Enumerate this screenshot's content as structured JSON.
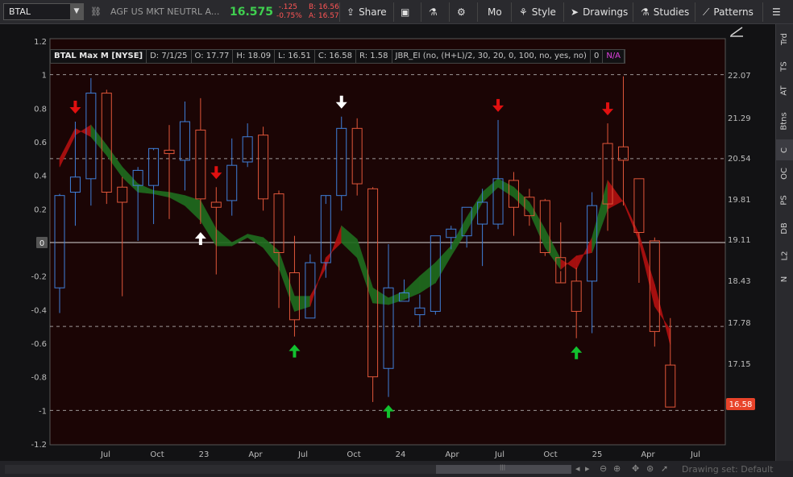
{
  "toolbar": {
    "symbol": "BTAL",
    "description": "AGF US MKT NEUTRL A...",
    "last_price": "16.575",
    "net_change": "-.125",
    "pct_change": "-0.75%",
    "bid": "B: 16.56",
    "ask": "A: 16.57",
    "share_label": "Share",
    "mo_label": "Mo",
    "style_label": "Style",
    "drawings_label": "Drawings",
    "studies_label": "Studies",
    "patterns_label": "Patterns",
    "icons": [
      "link-icon",
      "share-icon",
      "screenshot-icon",
      "flask-icon",
      "gear-icon",
      "style-icon",
      "cursor-icon",
      "studies-flask-icon",
      "patterns-icon",
      "menu-icon"
    ]
  },
  "header": {
    "title": "BTAL Max M [NYSE]",
    "date": "D: 7/1/25",
    "open": "O: 17.77",
    "high": "H: 18.09",
    "low": "L: 16.51",
    "close": "C: 16.58",
    "range": "R: 1.58",
    "study": "JBR_EI (no, (H+L)/2, 30, 20, 0, 100, no, yes, no)",
    "study_value": "0",
    "na": "N/A"
  },
  "sidebar_tabs": [
    "Trd",
    "TS",
    "AT",
    "Btns",
    "C",
    "OC",
    "PS",
    "DB",
    "L2",
    "N"
  ],
  "sidebar_active": "C",
  "bottom": {
    "drawing_set": "Drawing set: Default"
  },
  "colors": {
    "up_candle": "#3f7fd9",
    "down_candle": "#e0563a",
    "band_bull": "#1f6b1f",
    "band_bear": "#b01010",
    "arrow_down": "#e01010",
    "arrow_up_green": "#12c12f",
    "arrow_white": "#ffffff",
    "last_price_tag": "#e8432a"
  },
  "chart_data": {
    "type": "candlestick",
    "left_axis": {
      "ticks": [
        "1.2",
        "1",
        "0.8",
        "0.6",
        "0.4",
        "0.2",
        "0",
        "-0.2",
        "-0.4",
        "-0.6",
        "-0.8",
        "-1",
        "-1.2"
      ],
      "dashed_levels": [
        1,
        0.5,
        -0.5,
        -1
      ],
      "zero_level": 0,
      "zero_label": "0",
      "range": [
        -1.2,
        1.2
      ]
    },
    "right_axis": {
      "ticks": [
        "22.07",
        "21.29",
        "20.54",
        "19.81",
        "19.11",
        "18.43",
        "17.78",
        "17.15"
      ],
      "last_price_label": "16.58",
      "last_price": 16.58
    },
    "x_labels": [
      "Jul",
      "Oct",
      "23",
      "Apr",
      "Jul",
      "Oct",
      "24",
      "Apr",
      "Jul",
      "Oct",
      "25",
      "Apr",
      "Jul"
    ],
    "candles": [
      {
        "o": -0.27,
        "h": 0.29,
        "l": -0.42,
        "c": 0.28
      },
      {
        "o": 0.3,
        "h": 0.72,
        "l": 0.1,
        "c": 0.39
      },
      {
        "o": 0.38,
        "h": 0.98,
        "l": 0.22,
        "c": 0.89
      },
      {
        "o": 0.89,
        "h": 0.91,
        "l": 0.23,
        "c": 0.3
      },
      {
        "o": 0.33,
        "h": 0.39,
        "l": -0.32,
        "c": 0.24
      },
      {
        "o": 0.34,
        "h": 0.45,
        "l": 0.01,
        "c": 0.43
      },
      {
        "o": 0.34,
        "h": 0.55,
        "l": 0.11,
        "c": 0.56
      },
      {
        "o": 0.55,
        "h": 0.7,
        "l": 0.14,
        "c": 0.53
      },
      {
        "o": 0.49,
        "h": 0.84,
        "l": 0.31,
        "c": 0.72
      },
      {
        "o": 0.67,
        "h": 0.86,
        "l": 0.11,
        "c": 0.26
      },
      {
        "o": 0.24,
        "h": 0.33,
        "l": -0.19,
        "c": 0.21
      },
      {
        "o": 0.25,
        "h": 0.62,
        "l": 0.16,
        "c": 0.46
      },
      {
        "o": 0.48,
        "h": 0.71,
        "l": 0.45,
        "c": 0.63
      },
      {
        "o": 0.64,
        "h": 0.69,
        "l": 0.19,
        "c": 0.26
      },
      {
        "o": 0.29,
        "h": 0.31,
        "l": -0.39,
        "c": -0.06
      },
      {
        "o": -0.18,
        "h": 0.04,
        "l": -0.56,
        "c": -0.46
      },
      {
        "o": -0.45,
        "h": -0.07,
        "l": -0.45,
        "c": -0.12
      },
      {
        "o": -0.12,
        "h": 0.23,
        "l": -0.21,
        "c": 0.28
      },
      {
        "o": 0.28,
        "h": 0.75,
        "l": 0.19,
        "c": 0.68
      },
      {
        "o": 0.68,
        "h": 0.74,
        "l": 0.28,
        "c": 0.35
      },
      {
        "o": 0.32,
        "h": 0.33,
        "l": -0.95,
        "c": -0.8
      },
      {
        "o": -0.75,
        "h": -0.01,
        "l": -0.92,
        "c": -0.27
      },
      {
        "o": -0.35,
        "h": -0.22,
        "l": -0.35,
        "c": -0.3
      },
      {
        "o": -0.43,
        "h": -0.31,
        "l": -0.5,
        "c": -0.39
      },
      {
        "o": -0.41,
        "h": 0.04,
        "l": -0.43,
        "c": 0.04
      },
      {
        "o": 0.03,
        "h": 0.1,
        "l": -0.04,
        "c": 0.08
      },
      {
        "o": 0.04,
        "h": 0.21,
        "l": -0.03,
        "c": 0.21
      },
      {
        "o": 0.11,
        "h": 0.32,
        "l": -0.14,
        "c": 0.24
      },
      {
        "o": 0.11,
        "h": 0.73,
        "l": 0.08,
        "c": 0.38
      },
      {
        "o": 0.37,
        "h": 0.42,
        "l": 0.04,
        "c": 0.21
      },
      {
        "o": 0.27,
        "h": 0.32,
        "l": 0.1,
        "c": 0.16
      },
      {
        "o": 0.25,
        "h": 0.26,
        "l": -0.08,
        "c": -0.06
      },
      {
        "o": -0.09,
        "h": 0.12,
        "l": -0.17,
        "c": -0.24
      },
      {
        "o": -0.23,
        "h": -0.15,
        "l": -0.57,
        "c": -0.41
      },
      {
        "o": -0.23,
        "h": 0.3,
        "l": -0.54,
        "c": 0.22
      },
      {
        "o": 0.59,
        "h": 0.71,
        "l": 0.07,
        "c": 0.23
      },
      {
        "o": 0.57,
        "h": 0.99,
        "l": 0.22,
        "c": 0.49
      },
      {
        "o": 0.38,
        "h": 0.38,
        "l": -0.24,
        "c": 0.06
      },
      {
        "o": 0.01,
        "h": 0.03,
        "l": -0.62,
        "c": -0.53
      },
      {
        "o": -0.73,
        "h": -0.45,
        "l": -0.98,
        "c": -0.98
      }
    ],
    "band": {
      "upper": [
        0.45,
        0.64,
        0.7,
        0.58,
        0.45,
        0.35,
        0.31,
        0.3,
        0.28,
        0.25,
        0.08,
        0.0,
        0.05,
        0.03,
        -0.05,
        -0.32,
        -0.32,
        -0.15,
        0.1,
        0.02,
        -0.27,
        -0.33,
        -0.29,
        -0.2,
        -0.12,
        -0.02,
        0.15,
        0.3,
        0.38,
        0.33,
        0.24,
        0.08,
        -0.1,
        -0.16,
        0.03,
        0.37,
        0.24,
        0.01,
        -0.38,
        -0.52
      ],
      "lower": [
        0.5,
        0.68,
        0.63,
        0.52,
        0.39,
        0.3,
        0.29,
        0.27,
        0.22,
        0.13,
        -0.02,
        -0.02,
        0.03,
        -0.03,
        -0.15,
        -0.41,
        -0.38,
        -0.09,
        0.0,
        -0.09,
        -0.36,
        -0.37,
        -0.34,
        -0.3,
        -0.24,
        -0.08,
        0.07,
        0.24,
        0.33,
        0.27,
        0.18,
        -0.03,
        -0.16,
        -0.08,
        -0.06,
        0.2,
        0.25,
        0.05,
        -0.25,
        -0.61
      ]
    },
    "signals": [
      {
        "index": 1,
        "type": "down-red"
      },
      {
        "index": 9,
        "type": "up-white"
      },
      {
        "index": 10,
        "type": "down-red"
      },
      {
        "index": 15,
        "type": "up-green"
      },
      {
        "index": 18,
        "type": "down-white"
      },
      {
        "index": 21,
        "type": "up-green"
      },
      {
        "index": 28,
        "type": "down-red"
      },
      {
        "index": 33,
        "type": "up-green"
      },
      {
        "index": 35,
        "type": "down-red"
      }
    ]
  }
}
